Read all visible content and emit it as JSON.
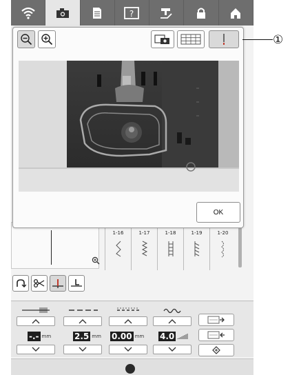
{
  "topbar": {
    "tabs": [
      {
        "icon": "wifi-icon",
        "active": false
      },
      {
        "icon": "camera-icon",
        "active": true
      },
      {
        "icon": "document-icon",
        "active": false
      },
      {
        "icon": "help-icon",
        "active": false
      },
      {
        "icon": "needle-mode-icon",
        "active": false
      },
      {
        "icon": "lock-icon",
        "active": false
      },
      {
        "icon": "home-icon",
        "active": false
      }
    ]
  },
  "camera_dialog": {
    "ok_label": "OK",
    "toolbar": [
      "zoom-out-icon",
      "zoom-in-icon",
      "camera-capture-icon",
      "grid-icon",
      "needle-position-icon"
    ]
  },
  "callout": {
    "label": "①"
  },
  "stitch_codes": [
    "1-16",
    "1-17",
    "1-18",
    "1-19",
    "1-20"
  ],
  "settings": {
    "width_value": "-.-",
    "width_unit": "mm",
    "length_value": "2.5",
    "length_unit": "mm",
    "offset_value": "0.00",
    "offset_unit": "mm",
    "tension_value": "4.0"
  },
  "colors": {
    "topbar": "#6e6e6e",
    "active_tab": "#e6e6e6",
    "value_bg": "#1e1e1e"
  }
}
